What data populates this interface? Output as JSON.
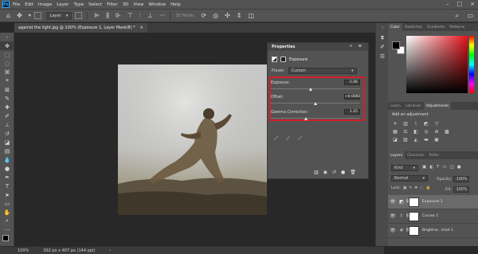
{
  "menubar": {
    "logo": "Ps",
    "items": [
      "File",
      "Edit",
      "Image",
      "Layer",
      "Type",
      "Select",
      "Filter",
      "3D",
      "View",
      "Window",
      "Help"
    ]
  },
  "optionsbar": {
    "auto_select_value": "Layer",
    "mode_label": "3D Mode:"
  },
  "document": {
    "tab_title": "against the light.jpg @ 100% (Exposure 1, Layer Mask/8) *",
    "close_glyph": "×"
  },
  "status": {
    "zoom": "100%",
    "doc_size": "392 px x 407 px (144 ppi)"
  },
  "properties": {
    "title": "Properties",
    "adjustment_name": "Exposure",
    "preset_label": "Preset:",
    "preset_value": "Custom",
    "params": [
      {
        "label": "Exposure:",
        "value": "-1.06",
        "thumb_frac": 0.45
      },
      {
        "label": "Offset:",
        "value": "+0.0083",
        "thumb_frac": 0.5
      },
      {
        "label": "Gamma Correction:",
        "value": "1.25",
        "thumb_frac": 0.4
      }
    ]
  },
  "right_panels": {
    "color_tabs": [
      "Color",
      "Swatches",
      "Gradients",
      "Patterns"
    ],
    "adjust_tabs": [
      "Learn",
      "Libraries",
      "Adjustments"
    ],
    "adjust_hint": "Add an adjustment",
    "layer_tabs": [
      "Layers",
      "Channels",
      "Paths"
    ],
    "kind_label": "Kind",
    "blend_mode": "Normal",
    "opacity_label": "Opacity:",
    "opacity_value": "100%",
    "lock_label": "Lock:",
    "fill_label": "Fill:",
    "fill_value": "100%",
    "layers": [
      {
        "name": "Exposure 1",
        "selected": true
      },
      {
        "name": "Curves 1",
        "selected": false
      },
      {
        "name": "Brightne...trast 1",
        "selected": false
      }
    ]
  },
  "colors": {
    "accent_red": "#d4202a",
    "foreground_swatch": "#000000",
    "background_swatch": "#ffffff"
  }
}
